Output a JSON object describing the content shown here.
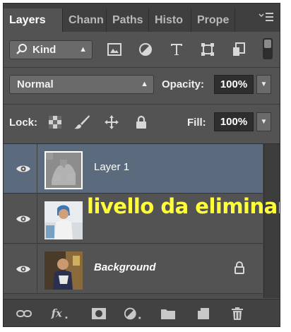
{
  "tabs": [
    {
      "label": "Layers",
      "active": true
    },
    {
      "label": "Chann"
    },
    {
      "label": "Paths"
    },
    {
      "label": "Histo"
    },
    {
      "label": "Prope"
    }
  ],
  "filter": {
    "kind_label": "Kind",
    "kind_icon": "search-icon"
  },
  "blend": {
    "mode": "Normal",
    "opacity_label": "Opacity:",
    "opacity_value": "100%"
  },
  "lock": {
    "label": "Lock:",
    "fill_label": "Fill:",
    "fill_value": "100%"
  },
  "layers": [
    {
      "name": "Layer 1",
      "selected": true
    },
    {
      "name": "",
      "selected": false
    },
    {
      "name": "Background",
      "locked": true
    }
  ],
  "overlay_text": "livello da eliminare",
  "ghost_text": "",
  "colors": {
    "panel": "#535353",
    "selected_row": "#5c6a7e",
    "overlay": "#ffff3a"
  }
}
